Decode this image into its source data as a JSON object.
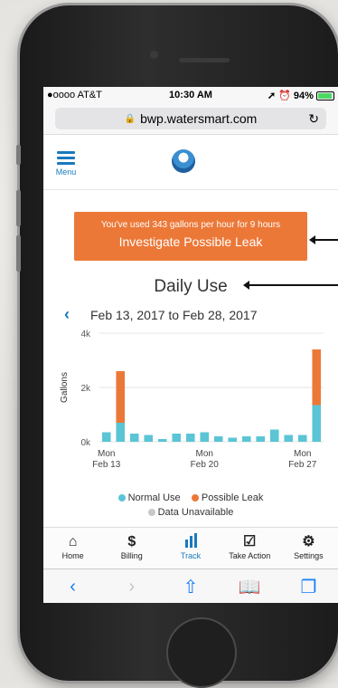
{
  "status": {
    "carrier": "●oooo AT&T",
    "time": "10:30 AM",
    "battery": "94%"
  },
  "browser": {
    "url": "bwp.watersmart.com"
  },
  "header": {
    "menu_label": "Menu"
  },
  "alert": {
    "line1": "You've used 343 gallons per hour for 9 hours",
    "line2": "Investigate Possible Leak"
  },
  "chart_data": {
    "type": "bar",
    "title": "Daily Use",
    "date_range": "Feb 13, 2017 to Feb 28, 2017",
    "ylabel": "Gallons",
    "ylim": [
      0,
      4000
    ],
    "yticks": [
      "0k",
      "2k",
      "4k"
    ],
    "xticks": [
      {
        "line1": "Mon",
        "line2": "Feb 13"
      },
      {
        "line1": "Mon",
        "line2": "Feb 20"
      },
      {
        "line1": "Mon",
        "line2": "Feb 27"
      }
    ],
    "categories": [
      "Feb 13",
      "Feb 14",
      "Feb 15",
      "Feb 16",
      "Feb 17",
      "Feb 18",
      "Feb 19",
      "Feb 20",
      "Feb 21",
      "Feb 22",
      "Feb 23",
      "Feb 24",
      "Feb 25",
      "Feb 26",
      "Feb 27",
      "Feb 28"
    ],
    "series": [
      {
        "name": "Normal Use",
        "color": "#5bc5d6",
        "values": [
          350,
          700,
          300,
          250,
          100,
          300,
          300,
          350,
          200,
          150,
          200,
          200,
          450,
          250,
          250,
          1350
        ]
      },
      {
        "name": "Possible Leak",
        "color": "#ec7838",
        "values": [
          0,
          1900,
          0,
          0,
          0,
          0,
          0,
          0,
          0,
          0,
          0,
          0,
          0,
          0,
          0,
          2050
        ]
      }
    ],
    "legend": [
      {
        "label": "Normal Use",
        "color": "#5bc5d6"
      },
      {
        "label": "Possible Leak",
        "color": "#ec7838"
      },
      {
        "label": "Data Unavailable",
        "color": "#c8c8c8"
      }
    ]
  },
  "tabs": [
    {
      "label": "Home",
      "icon": "home-icon"
    },
    {
      "label": "Billing",
      "icon": "dollar-icon"
    },
    {
      "label": "Track",
      "icon": "bar-chart-icon"
    },
    {
      "label": "Take Action",
      "icon": "checkbox-icon"
    },
    {
      "label": "Settings",
      "icon": "gear-icon"
    }
  ]
}
